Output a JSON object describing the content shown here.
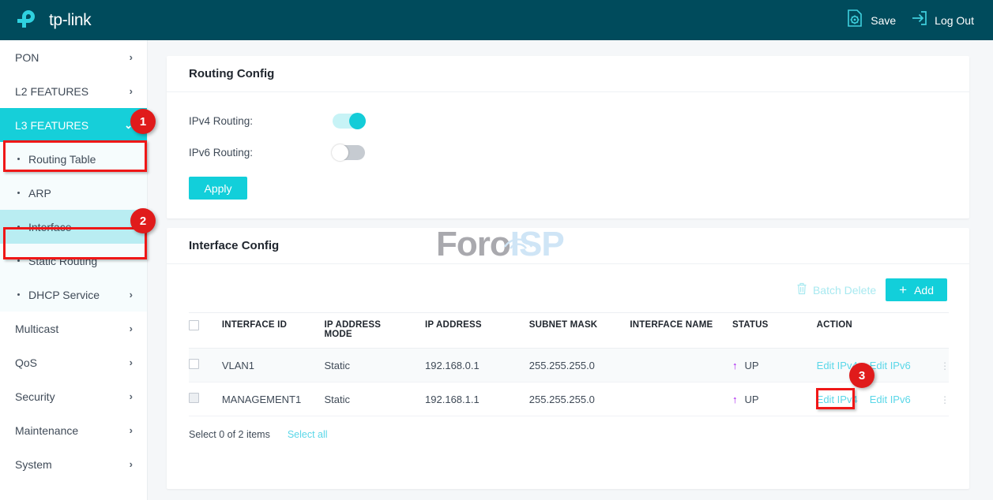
{
  "header": {
    "brand": "tp-link",
    "brand_logo_icon": "tplink-logo-icon",
    "actions": [
      {
        "label": "Save",
        "icon": "save-gear-document-icon"
      },
      {
        "label": "Log Out",
        "icon": "logout-arrow-icon"
      }
    ]
  },
  "sidebar": {
    "items": [
      {
        "label": "PON",
        "icon": "chevron-right-icon",
        "state": "collapsed"
      },
      {
        "label": "L2 FEATURES",
        "icon": "chevron-right-icon",
        "state": "collapsed"
      },
      {
        "label": "L3 FEATURES",
        "icon": "chevron-down-icon",
        "state": "expanded-active"
      }
    ],
    "submenu": [
      {
        "label": "Routing Table",
        "selected": false
      },
      {
        "label": "ARP",
        "selected": false
      },
      {
        "label": "Interface",
        "selected": true
      },
      {
        "label": "Static Routing",
        "selected": false
      },
      {
        "label": "DHCP Service",
        "selected": false,
        "icon": "chevron-right-icon"
      }
    ],
    "items_after": [
      {
        "label": "Multicast",
        "icon": "chevron-right-icon"
      },
      {
        "label": "QoS",
        "icon": "chevron-right-icon"
      },
      {
        "label": "Security",
        "icon": "chevron-right-icon"
      },
      {
        "label": "Maintenance",
        "icon": "chevron-right-icon"
      },
      {
        "label": "System",
        "icon": "chevron-right-icon"
      }
    ]
  },
  "routing_config": {
    "title": "Routing Config",
    "ipv4_label": "IPv4 Routing:",
    "ipv4_enabled": true,
    "ipv6_label": "IPv6 Routing:",
    "ipv6_enabled": false,
    "apply_label": "Apply"
  },
  "interface_config": {
    "title": "Interface Config",
    "toolbar": {
      "batch_delete_label": "Batch Delete",
      "batch_delete_icon": "trash-icon",
      "batch_delete_enabled": false,
      "add_label": "Add",
      "add_icon": "plus-icon"
    },
    "columns": [
      "INTERFACE ID",
      "IP ADDRESS MODE",
      "IP ADDRESS",
      "SUBNET MASK",
      "INTERFACE NAME",
      "STATUS",
      "ACTION"
    ],
    "rows": [
      {
        "interface_id": "VLAN1",
        "ip_address_mode": "Static",
        "ip_address": "192.168.0.1",
        "subnet_mask": "255.255.255.0",
        "interface_name": "",
        "status": "UP",
        "status_icon": "arrow-up-icon",
        "action_ipv4": "Edit IPv4",
        "action_ipv6": "Edit IPv6",
        "menu_icon": "kebab-menu-icon",
        "checked": false
      },
      {
        "interface_id": "MANAGEMENT1",
        "ip_address_mode": "Static",
        "ip_address": "192.168.1.1",
        "subnet_mask": "255.255.255.0",
        "interface_name": "",
        "status": "UP",
        "status_icon": "arrow-up-icon",
        "action_ipv4": "Edit IPv4",
        "action_ipv6": "Edit IPv6",
        "menu_icon": "kebab-menu-icon",
        "checked": false
      }
    ],
    "footer": {
      "selection_text": "Select 0 of 2 items",
      "select_all_label": "Select all"
    }
  },
  "watermark": {
    "text_primary": "Foro",
    "text_secondary": "ISP"
  },
  "annotations": [
    {
      "number": "1",
      "target": "sidebar-item-l3-features"
    },
    {
      "number": "2",
      "target": "sidebar-subitem-interface"
    },
    {
      "number": "3",
      "target": "edit-ipv4-link-row-2"
    }
  ],
  "colors": {
    "brand_dark": "#004b5c",
    "accent_cyan": "#12cfda",
    "link_cyan": "#5ad7e8",
    "status_arrow": "#a615ef",
    "annotation_red": "#ef1717"
  }
}
